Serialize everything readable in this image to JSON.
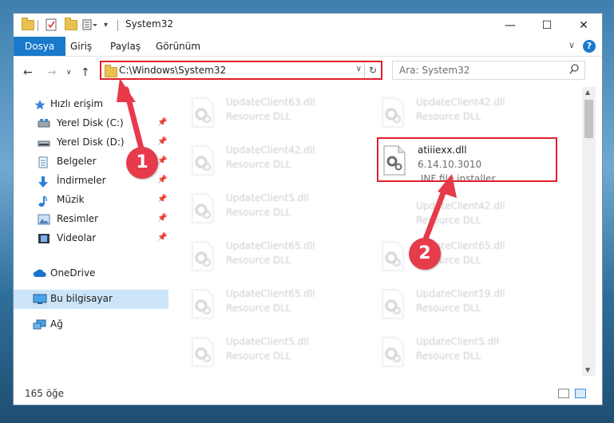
{
  "window": {
    "title": "System32"
  },
  "ribbon": {
    "tabs": [
      "Dosya",
      "Giriş",
      "Paylaş",
      "Görünüm"
    ],
    "help": "?"
  },
  "window_buttons": {
    "minimize": "—",
    "maximize": "☐",
    "close": "✕"
  },
  "nav": {
    "address": "C:\\Windows\\System32",
    "search_placeholder": "Ara: System32"
  },
  "sidebar": {
    "items": [
      {
        "label": "Hızlı erişim",
        "icon": "star-icon"
      },
      {
        "label": "Yerel Disk (C:)",
        "icon": "drive-icon"
      },
      {
        "label": "Yerel Disk (D:)",
        "icon": "drive-icon"
      },
      {
        "label": "Belgeler",
        "icon": "documents-icon"
      },
      {
        "label": "İndirmeler",
        "icon": "download-icon"
      },
      {
        "label": "Müzik",
        "icon": "music-icon"
      },
      {
        "label": "Resimler",
        "icon": "pictures-icon"
      },
      {
        "label": "Videolar",
        "icon": "videos-icon"
      },
      {
        "label": "OneDrive",
        "icon": "cloud-icon"
      },
      {
        "label": "Bu bilgisayar",
        "icon": "computer-icon"
      },
      {
        "label": "Ağ",
        "icon": "network-icon"
      }
    ]
  },
  "files": [
    {
      "name": "UpdateClient63.dll",
      "sub": "Resource DLL"
    },
    {
      "name": "UpdateClient42.dll",
      "sub": "Resource DLL"
    },
    {
      "name": "UpdateClient42.dll",
      "sub": "Resource DLL"
    },
    {
      "name": "atiiiexx.dll",
      "sub": "6.14.10.3010",
      "sub2": ".INF file installer"
    },
    {
      "name": "UpdateClient5.dll",
      "sub": "Resource DLL"
    },
    {
      "name": "UpdateClient42.dll",
      "sub": "Resource DLL"
    },
    {
      "name": "UpdateClient65.dll",
      "sub": "Resource DLL"
    },
    {
      "name": "UpdateClient65.dll",
      "sub": "Resource DLL"
    },
    {
      "name": "UpdateClient65.dll",
      "sub": "Resource DLL"
    },
    {
      "name": "UpdateClient19.dll",
      "sub": "Resource DLL"
    },
    {
      "name": "UpdateClient5.dll",
      "sub": "Resource DLL"
    },
    {
      "name": "UpdateClient5.dll",
      "sub": "Resource DLL"
    }
  ],
  "status": {
    "count": "165 öğe"
  },
  "callouts": {
    "one": "1",
    "two": "2"
  },
  "colors": {
    "accent": "#1979ca",
    "highlight": "#e0202a",
    "callout": "#e63b4a"
  }
}
